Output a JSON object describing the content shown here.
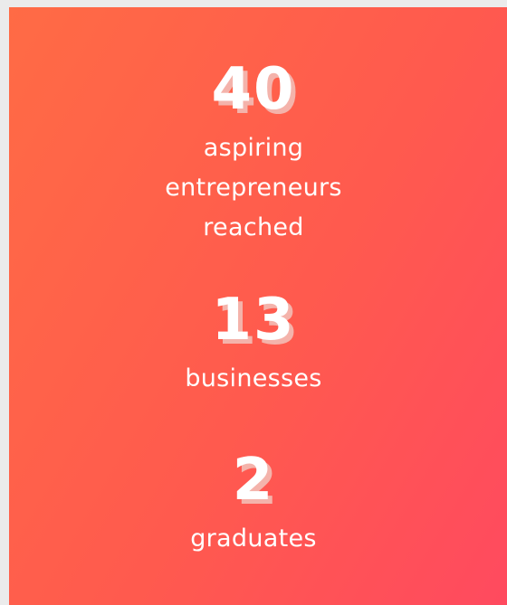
{
  "colors": {
    "page_background": "#ebebeb",
    "gradient_start": "#ff6b45",
    "gradient_end": "#ff4a5f",
    "text": "#ffffff",
    "number_shadow": "#f4b3ab"
  },
  "stats": [
    {
      "number": "40",
      "label_lines": [
        "aspiring",
        "entrepreneurs",
        "reached"
      ]
    },
    {
      "number": "13",
      "label_lines": [
        "businesses"
      ]
    },
    {
      "number": "2",
      "label_lines": [
        "graduates"
      ]
    }
  ]
}
